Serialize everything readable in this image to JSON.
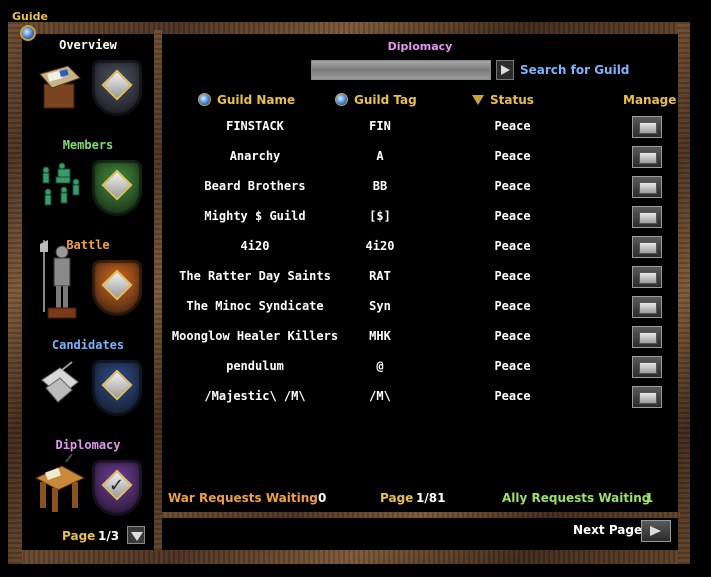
{
  "window": {
    "title": "Guide"
  },
  "sidebar": {
    "sections": [
      {
        "label": "Overview",
        "color": "#ffffff",
        "shield_color": "#4a4e5e"
      },
      {
        "label": "Members",
        "color": "#7be06a",
        "shield_color": "#3f8a3a"
      },
      {
        "label": "Battle",
        "color": "#f0a040",
        "shield_color": "#d0661e"
      },
      {
        "label": "Candidates",
        "color": "#7db2ff",
        "shield_color": "#2e4a86"
      },
      {
        "label": "Diplomacy",
        "color": "#e496f0",
        "shield_color": "#6e3a96"
      }
    ],
    "page_label": "Page",
    "page_value": "1/3"
  },
  "main": {
    "title": "Diplomacy",
    "search": {
      "value": "",
      "placeholder": "",
      "label": "Search for Guild"
    },
    "columns": {
      "name": "Guild Name",
      "tag": "Guild Tag",
      "status": "Status",
      "manage": "Manage"
    },
    "rows": [
      {
        "name": "FINSTACK",
        "tag": "FIN",
        "status": "Peace"
      },
      {
        "name": "Anarchy",
        "tag": "A",
        "status": "Peace"
      },
      {
        "name": "Beard Brothers",
        "tag": "BB",
        "status": "Peace"
      },
      {
        "name": "Mighty $ Guild",
        "tag": "[$]",
        "status": "Peace"
      },
      {
        "name": "4i20",
        "tag": "4i20",
        "status": "Peace"
      },
      {
        "name": "The Ratter Day Saints",
        "tag": "RAT",
        "status": "Peace"
      },
      {
        "name": "The Minoc Syndicate",
        "tag": "Syn",
        "status": "Peace"
      },
      {
        "name": "Moonglow Healer Killers",
        "tag": "MHK",
        "status": "Peace"
      },
      {
        "name": "pendulum",
        "tag": "@",
        "status": "Peace"
      },
      {
        "name": "/Majestic\\  /M\\",
        "tag": "/M\\",
        "status": "Peace"
      }
    ],
    "footer": {
      "war_label": "War Requests Waiting",
      "war_value": "0",
      "page_label": "Page",
      "page_value": "1/81",
      "ally_label": "Ally Requests Waiting",
      "ally_value": "1",
      "next_label": "Next Page"
    }
  }
}
